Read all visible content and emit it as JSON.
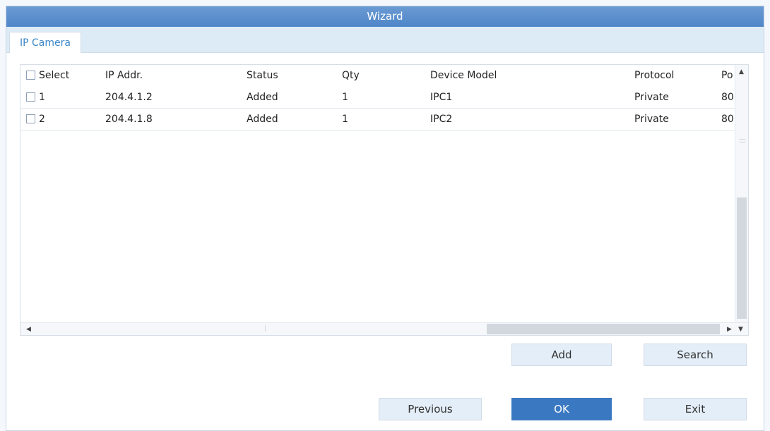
{
  "window": {
    "title": "Wizard"
  },
  "tabs": [
    {
      "label": "IP Camera"
    }
  ],
  "table": {
    "columns": [
      {
        "label": "Select"
      },
      {
        "label": "IP Addr."
      },
      {
        "label": "Status"
      },
      {
        "label": "Qty"
      },
      {
        "label": "Device Model"
      },
      {
        "label": "Protocol"
      },
      {
        "label": "Po"
      }
    ],
    "rows": [
      {
        "select": "1",
        "ip": "204.4.1.2",
        "status": "Added",
        "qty": "1",
        "model": "IPC1",
        "protocol": "Private",
        "port": "80"
      },
      {
        "select": "2",
        "ip": "204.4.1.8",
        "status": "Added",
        "qty": "1",
        "model": "IPC2",
        "protocol": "Private",
        "port": "80"
      }
    ]
  },
  "buttons": {
    "add": "Add",
    "search": "Search",
    "previous": "Previous",
    "ok": "OK",
    "exit": "Exit"
  },
  "icons": {
    "scroll_up": "triangle-up",
    "scroll_down": "triangle-down",
    "scroll_left": "triangle-left",
    "scroll_right": "triangle-right"
  },
  "colors": {
    "titlebar": "#5a8fcd",
    "tab_text": "#3a86c8",
    "primary_button": "#3a78c2",
    "secondary_button": "#e4eef8"
  }
}
